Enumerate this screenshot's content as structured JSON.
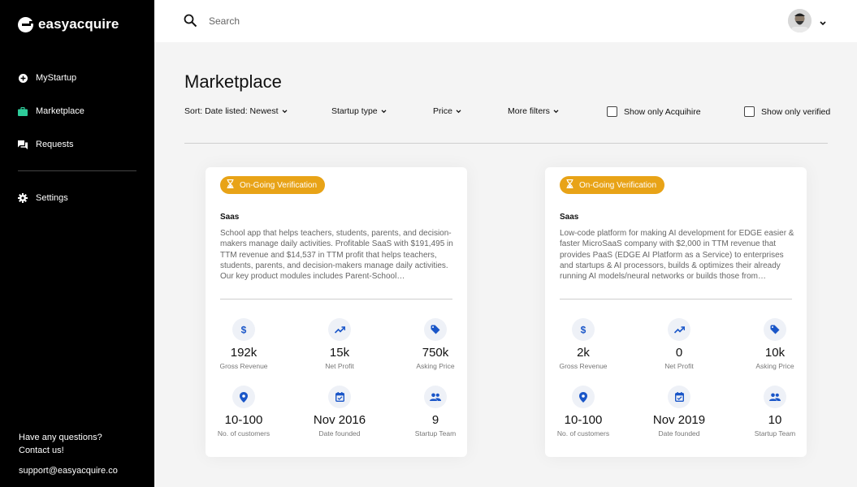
{
  "brand": {
    "name": "easyacquire"
  },
  "sidebar": {
    "items": [
      {
        "label": "MyStartup",
        "icon": "plus-circle-icon"
      },
      {
        "label": "Marketplace",
        "icon": "briefcase-icon"
      },
      {
        "label": "Requests",
        "icon": "chat-icon"
      }
    ],
    "settings": {
      "label": "Settings",
      "icon": "gear-icon"
    },
    "help_line1": "Have any questions?",
    "help_line2": "Contact us!",
    "support_email": "support@easyacquire.co"
  },
  "search": {
    "placeholder": "Search"
  },
  "main": {
    "title": "Marketplace",
    "filters": {
      "sort": "Sort: Date listed: Newest",
      "startup_type": "Startup type",
      "price": "Price",
      "more": "More filters",
      "acquihire": "Show only Acquihire",
      "verified": "Show only verified"
    }
  },
  "colors": {
    "accent": "#e8a317",
    "icon_blue": "#1a56c8",
    "sidebar_active": "#2ecc9a"
  },
  "listings": [
    {
      "badge": "On-Going Verification",
      "type": "Saas",
      "description": "School app that helps teachers, students, parents, and decision-makers manage daily activities. Profitable SaaS with $191,495 in TTM revenue and $14,537 in TTM profit that helps teachers, students, parents, and decision-makers manage daily activities. Our key product modules includes Parent-School…",
      "stats": [
        {
          "value": "192k",
          "label": "Gross Revenue",
          "icon": "dollar-icon"
        },
        {
          "value": "15k",
          "label": "Net Profit",
          "icon": "trending-up-icon"
        },
        {
          "value": "750k",
          "label": "Asking Price",
          "icon": "tag-icon"
        },
        {
          "value": "10-100",
          "label": "No. of customers",
          "icon": "location-pin-icon"
        },
        {
          "value": "Nov 2016",
          "label": "Date founded",
          "icon": "calendar-icon"
        },
        {
          "value": "9",
          "label": "Startup Team",
          "icon": "people-icon"
        }
      ]
    },
    {
      "badge": "On-Going Verification",
      "type": "Saas",
      "description": "Low-code platform for making AI development for EDGE easier & faster MicroSaaS company with $2,000 in TTM revenue that provides PaaS (EDGE AI Platform as a Service) to enterprises and startups & AI processors, builds & optimizes their already running AI models/neural networks or builds those from…",
      "stats": [
        {
          "value": "2k",
          "label": "Gross Revenue",
          "icon": "dollar-icon"
        },
        {
          "value": "0",
          "label": "Net Profit",
          "icon": "trending-up-icon"
        },
        {
          "value": "10k",
          "label": "Asking Price",
          "icon": "tag-icon"
        },
        {
          "value": "10-100",
          "label": "No. of customers",
          "icon": "location-pin-icon"
        },
        {
          "value": "Nov 2019",
          "label": "Date founded",
          "icon": "calendar-icon"
        },
        {
          "value": "10",
          "label": "Startup Team",
          "icon": "people-icon"
        }
      ]
    }
  ]
}
